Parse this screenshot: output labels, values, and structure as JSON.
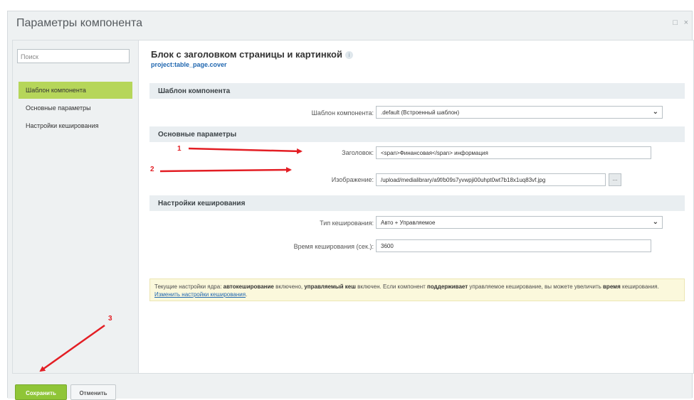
{
  "window": {
    "title": "Параметры компонента",
    "expand_glyph": "□",
    "close_glyph": "×"
  },
  "sidebar": {
    "search_placeholder": "Поиск",
    "items": [
      {
        "label": "Шаблон компонента",
        "active": true
      },
      {
        "label": "Основные параметры",
        "active": false
      },
      {
        "label": "Настройки кеширования",
        "active": false
      }
    ]
  },
  "main": {
    "title": "Блок с заголовком страницы и картинкой",
    "info_icon": "i",
    "component_code": "project:table_page.cover",
    "sections": {
      "template": {
        "header": "Шаблон компонента",
        "template_label": "Шаблон компонента:",
        "template_value": ".default (Встроенный шаблон)"
      },
      "main_params": {
        "header": "Основные параметры",
        "title_label": "Заголовок:",
        "title_value": "<span>Финансовая</span> информация",
        "image_label": "Изображение:",
        "image_value": "/upload/medialibrary/a9f/b09s7yvwpji00uhpt0wt7b18x1uq83vf.jpg",
        "image_button": "..."
      },
      "cache": {
        "header": "Настройки кеширования",
        "cache_type_label": "Тип кеширования:",
        "cache_type_value": "Авто + Управляемое",
        "cache_time_label": "Время кеширования (сек.):",
        "cache_time_value": "3600"
      }
    },
    "notice": {
      "part1": "Текущие настройки ядра: ",
      "bold1": "автокеширование",
      "part2": " включено, ",
      "bold2": "управляемый кеш",
      "part3": " включен. Если компонент ",
      "bold3": "поддерживает",
      "part4": " управляемое кеширование, вы можете увеличить ",
      "bold4": "время",
      "part5": " кеширования. ",
      "link": "Изменить настройки кеширования",
      "end": "."
    }
  },
  "footer": {
    "save_label": "Сохранить",
    "cancel_label": "Отменить"
  },
  "annotations": {
    "color": "#e31e24",
    "markers": [
      "1",
      "2",
      "3"
    ]
  }
}
